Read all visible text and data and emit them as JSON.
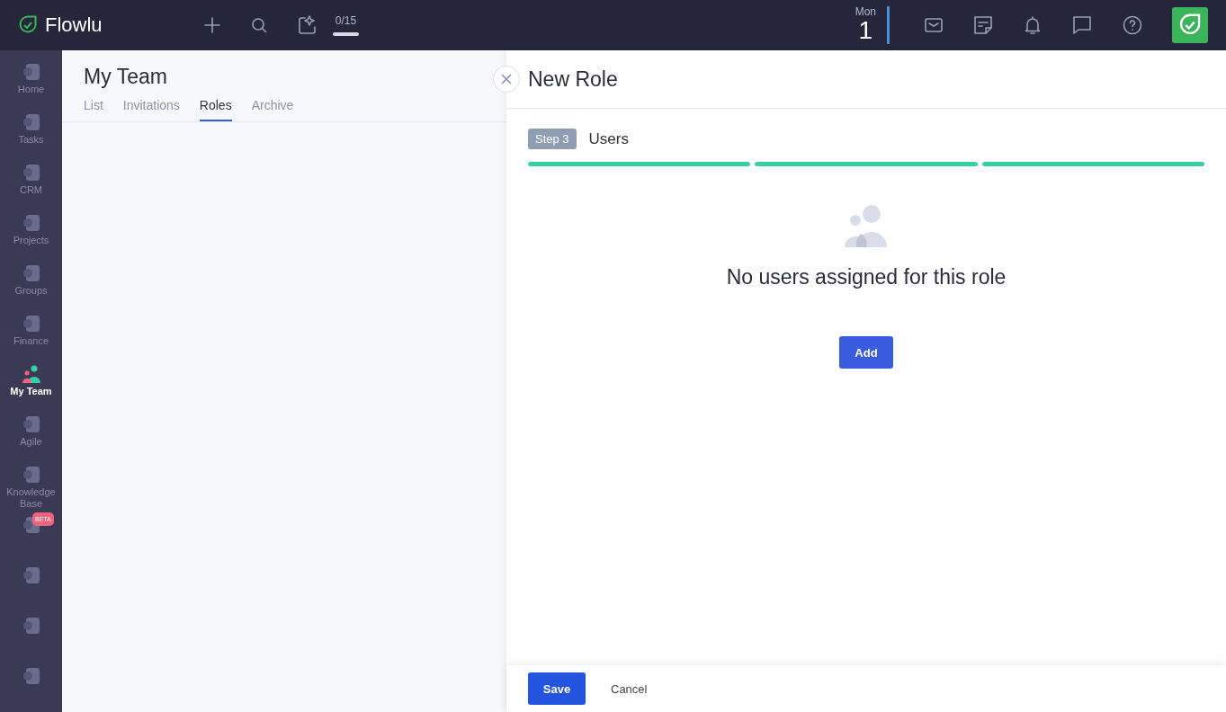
{
  "topbar": {
    "logo": "Flowlu",
    "counter": "0/15",
    "date": {
      "weekday": "Mon",
      "day": "1"
    }
  },
  "sidebar": {
    "items": [
      {
        "label": "Home",
        "selected": false
      },
      {
        "label": "Tasks",
        "selected": false
      },
      {
        "label": "CRM",
        "selected": false
      },
      {
        "label": "Projects",
        "selected": false
      },
      {
        "label": "Groups",
        "selected": false
      },
      {
        "label": "Finance",
        "selected": false
      },
      {
        "label": "My Team",
        "selected": true
      },
      {
        "label": "Agile",
        "selected": false
      },
      {
        "label": "Knowledge Base",
        "selected": false
      },
      {
        "badge": "BETA",
        "selected": false
      },
      {
        "selected": false
      },
      {
        "selected": false
      },
      {
        "selected": false
      }
    ]
  },
  "page": {
    "title": "My Team",
    "tabs": [
      {
        "label": "List",
        "selected": false
      },
      {
        "label": "Invitations",
        "selected": false
      },
      {
        "label": "Roles",
        "selected": true
      },
      {
        "label": "Archive",
        "selected": false
      }
    ]
  },
  "panel": {
    "title": "New Role",
    "step": {
      "badge": "Step 3",
      "title": "Users"
    },
    "progress": [
      {
        "level": 1
      },
      {
        "level": 1
      },
      {
        "level": 1
      }
    ],
    "empty_message": "No users assigned for this role",
    "add_button": "Add",
    "footer": {
      "save": "Save",
      "cancel": "Cancel"
    }
  }
}
